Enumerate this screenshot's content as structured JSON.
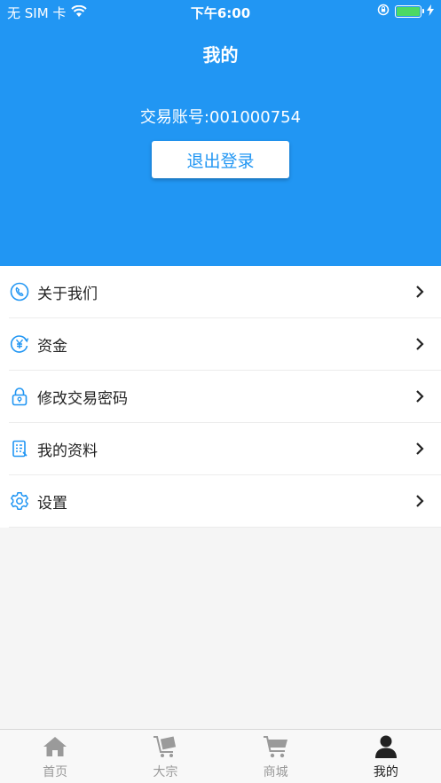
{
  "status_bar": {
    "carrier": "无 SIM 卡",
    "time": "下午6:00",
    "battery_level": 1.0
  },
  "header": {
    "title": "我的",
    "account_text": "交易账号:001000754",
    "logout_label": "退出登录"
  },
  "menu": {
    "items": [
      {
        "label": "关于我们",
        "icon": "phone-icon"
      },
      {
        "label": "资金",
        "icon": "yen-icon"
      },
      {
        "label": "修改交易密码",
        "icon": "lock-icon"
      },
      {
        "label": "我的资料",
        "icon": "document-icon"
      },
      {
        "label": "设置",
        "icon": "gear-icon"
      }
    ]
  },
  "tabbar": {
    "active": "我的",
    "tabs": [
      {
        "label": "首页",
        "icon": "home-icon"
      },
      {
        "label": "大宗",
        "icon": "cart-box-icon"
      },
      {
        "label": "商城",
        "icon": "shopping-cart-icon"
      },
      {
        "label": "我的",
        "icon": "user-icon"
      }
    ]
  },
  "colors": {
    "primary": "#2196f3",
    "battery": "#4cd964"
  }
}
